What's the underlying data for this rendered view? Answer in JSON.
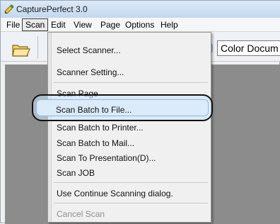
{
  "window": {
    "title": "CapturePerfect 3.0"
  },
  "menubar": {
    "items": [
      "File",
      "Scan",
      "Edit",
      "View",
      "Page",
      "Options",
      "Help"
    ]
  },
  "toolbar": {
    "color_mode_value": "Color Docum"
  },
  "scan_menu": {
    "items": [
      "Select Scanner...",
      "Scanner Setting...",
      "Scan Page",
      "Scan Batch to File...",
      "Scan Batch to Printer...",
      "Scan Batch to Mail...",
      "Scan To Presentation(D)...",
      "Scan JOB",
      "Use Continue Scanning dialog.",
      "Cancel Scan"
    ],
    "highlighted_index": 3,
    "disabled_index": 9
  },
  "icons": {
    "app": "capture-app-icon",
    "open": "open-folder-icon",
    "scanner_tool": "scanner-tool-icon"
  }
}
